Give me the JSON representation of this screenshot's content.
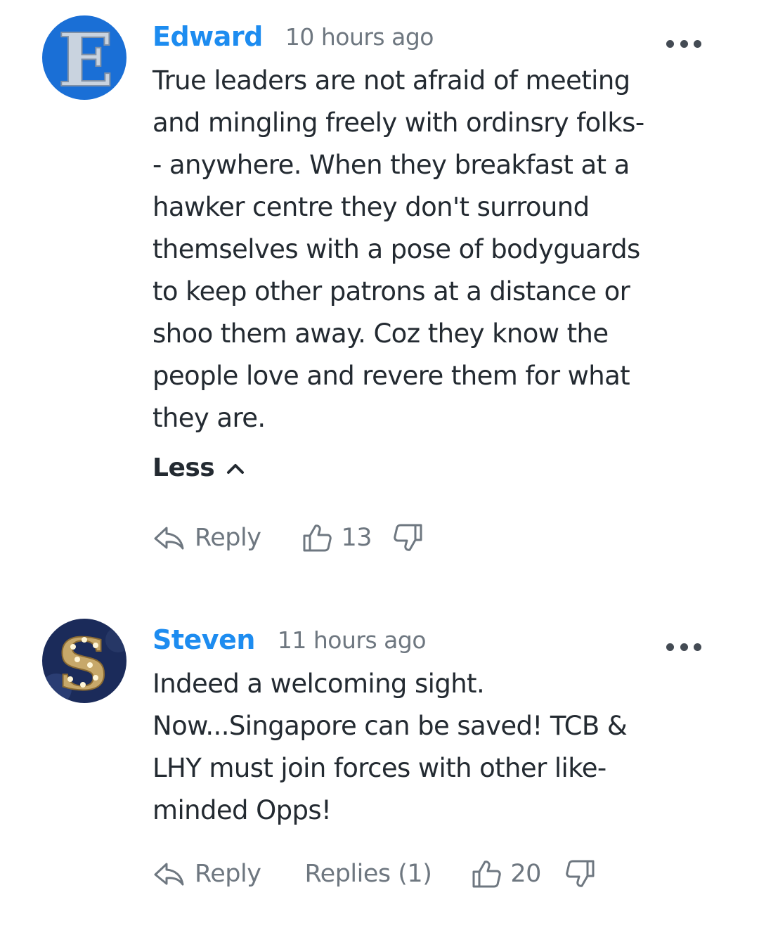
{
  "comments": [
    {
      "author": "Edward",
      "avatar_letter": "E",
      "time": "10 hours ago",
      "lines": [
        "True leaders are not afraid of meeting",
        "and mingling freely with ordinsry folks-",
        "- anywhere. When they breakfast at a",
        "hawker centre they don't surround",
        "themselves with a pose of bodyguards",
        "to keep other patrons at a distance or",
        "shoo them away. Coz they know the",
        "people love and revere them for what",
        "they are."
      ],
      "less_label": "Less",
      "reply_label": "Reply",
      "likes": "13"
    },
    {
      "author": "Steven",
      "avatar_letter": "S",
      "time": "11 hours ago",
      "lines": [
        "Indeed a welcoming sight.",
        "Now...Singapore can be saved! TCB &",
        "LHY must join forces with other like-",
        "minded Opps!"
      ],
      "reply_label": "Reply",
      "replies_label": "Replies (1)",
      "likes": "20"
    }
  ],
  "icons": {
    "more": "more-options-icon",
    "reply": "reply-arrow-icon",
    "like": "thumbs-up-icon",
    "dislike": "thumbs-down-icon",
    "less": "chevron-up-icon"
  },
  "colors": {
    "author": "#1d8cf0",
    "meta": "#6e7780",
    "text": "#232a31",
    "edward_avatar": "#1a6fd6",
    "steven_avatar": "#1b2b5a"
  }
}
